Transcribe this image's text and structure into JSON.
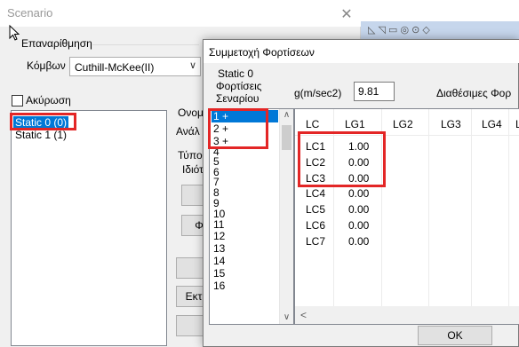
{
  "scenario_window": {
    "title": "Scenario",
    "close_glyph": "✕",
    "renumbering": {
      "group_label": "Επαναρίθμηση",
      "nodes_label": "Κόμβων",
      "method_value": "Cuthill-McKee(II)"
    },
    "cancel_label": "Ακύρωση",
    "static_list": [
      "Static 0 (0)",
      "Static 1 (1)"
    ],
    "clipped_labels": [
      "Ονομ",
      "Ανάλ",
      "Τύπος",
      "Ιδιότ"
    ],
    "clipped_buttons": [
      "",
      "Φ",
      "",
      "Εκτ",
      ""
    ]
  },
  "load_dialog": {
    "title": "Συμμετοχή Φορτίσεων",
    "static_label": "Static 0",
    "scenario_loads_label_line1": "Φορτίσεις",
    "scenario_loads_label_line2": "Σεναρίου",
    "g_label": "g(m/sec2)",
    "g_value": "9.81",
    "available_label": "Διαθέσιμες Φορ",
    "load_numbers": [
      "1 +",
      "2 +",
      "3 +",
      "4",
      "5",
      "6",
      "7",
      "8",
      "9",
      "10",
      "11",
      "12",
      "13",
      "14",
      "15",
      "16"
    ],
    "grid": {
      "columns": [
        "LC",
        "LG1",
        "LG2",
        "LG3",
        "LG4",
        "L"
      ],
      "rows": [
        {
          "lc": "LC1",
          "lg1": "1.00"
        },
        {
          "lc": "LC2",
          "lg1": "0.00"
        },
        {
          "lc": "LC3",
          "lg1": "0.00"
        },
        {
          "lc": "LC4",
          "lg1": "0.00"
        },
        {
          "lc": "LC5",
          "lg1": "0.00"
        },
        {
          "lc": "LC6",
          "lg1": "0.00"
        },
        {
          "lc": "LC7",
          "lg1": "0.00"
        }
      ]
    },
    "ok_label": "OK"
  },
  "icons": {
    "scroll_up": "∧",
    "scroll_down": "∨",
    "scroll_left": "<",
    "combo_arrow": "∨"
  },
  "colors": {
    "selection": "#0078d7",
    "highlight_box": "#e32626"
  }
}
